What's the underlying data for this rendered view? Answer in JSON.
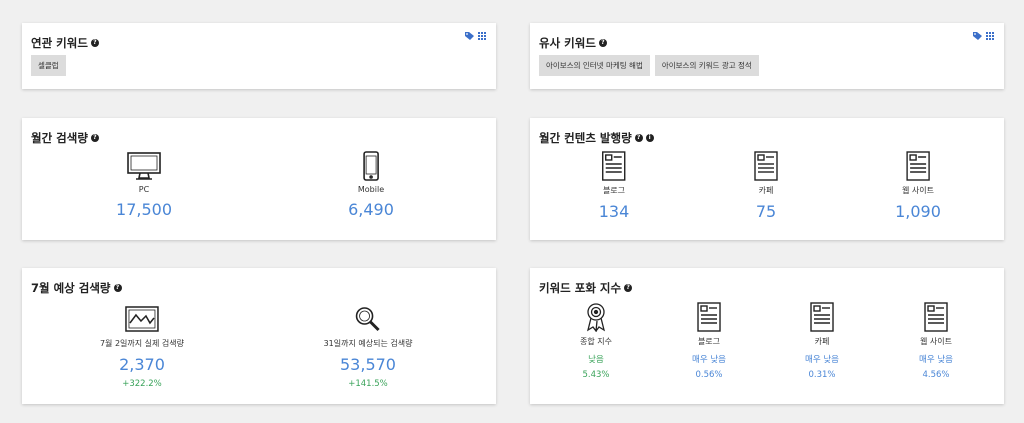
{
  "related": {
    "title": "연관 키워드",
    "chips": [
      "셀클럽"
    ]
  },
  "similar": {
    "title": "유사 키워드",
    "chips": [
      "아이보스의 인터넷 마케팅 해법",
      "아이보스의 키워드 광고 정석"
    ]
  },
  "monthly_search": {
    "title": "월간 검색량",
    "pc": {
      "label": "PC",
      "value": "17,500"
    },
    "mobile": {
      "label": "Mobile",
      "value": "6,490"
    }
  },
  "monthly_content": {
    "title": "월간 컨텐츠 발행량",
    "blog": {
      "label": "블로그",
      "value": "134"
    },
    "cafe": {
      "label": "카페",
      "value": "75"
    },
    "web": {
      "label": "웹 사이트",
      "value": "1,090"
    }
  },
  "forecast": {
    "title": "7월 예상 검색량",
    "actual": {
      "label": "7월 2일까지 실제 검색량",
      "value": "2,370",
      "change": "+322.2%"
    },
    "expected": {
      "label": "31일까지 예상되는 검색량",
      "value": "53,570",
      "change": "+141.5%"
    }
  },
  "saturation": {
    "title": "키워드 포화 지수",
    "total": {
      "label": "종합 지수",
      "level": "낮음",
      "pct": "5.43%"
    },
    "blog": {
      "label": "블로그",
      "level": "매우 낮음",
      "pct": "0.56%"
    },
    "cafe": {
      "label": "카페",
      "level": "매우 낮음",
      "pct": "0.31%"
    },
    "web": {
      "label": "웹 사이트",
      "level": "매우 낮음",
      "pct": "4.56%"
    }
  },
  "colors": {
    "value_blue": "#4a86d6",
    "positive_green": "#3aa35a"
  }
}
